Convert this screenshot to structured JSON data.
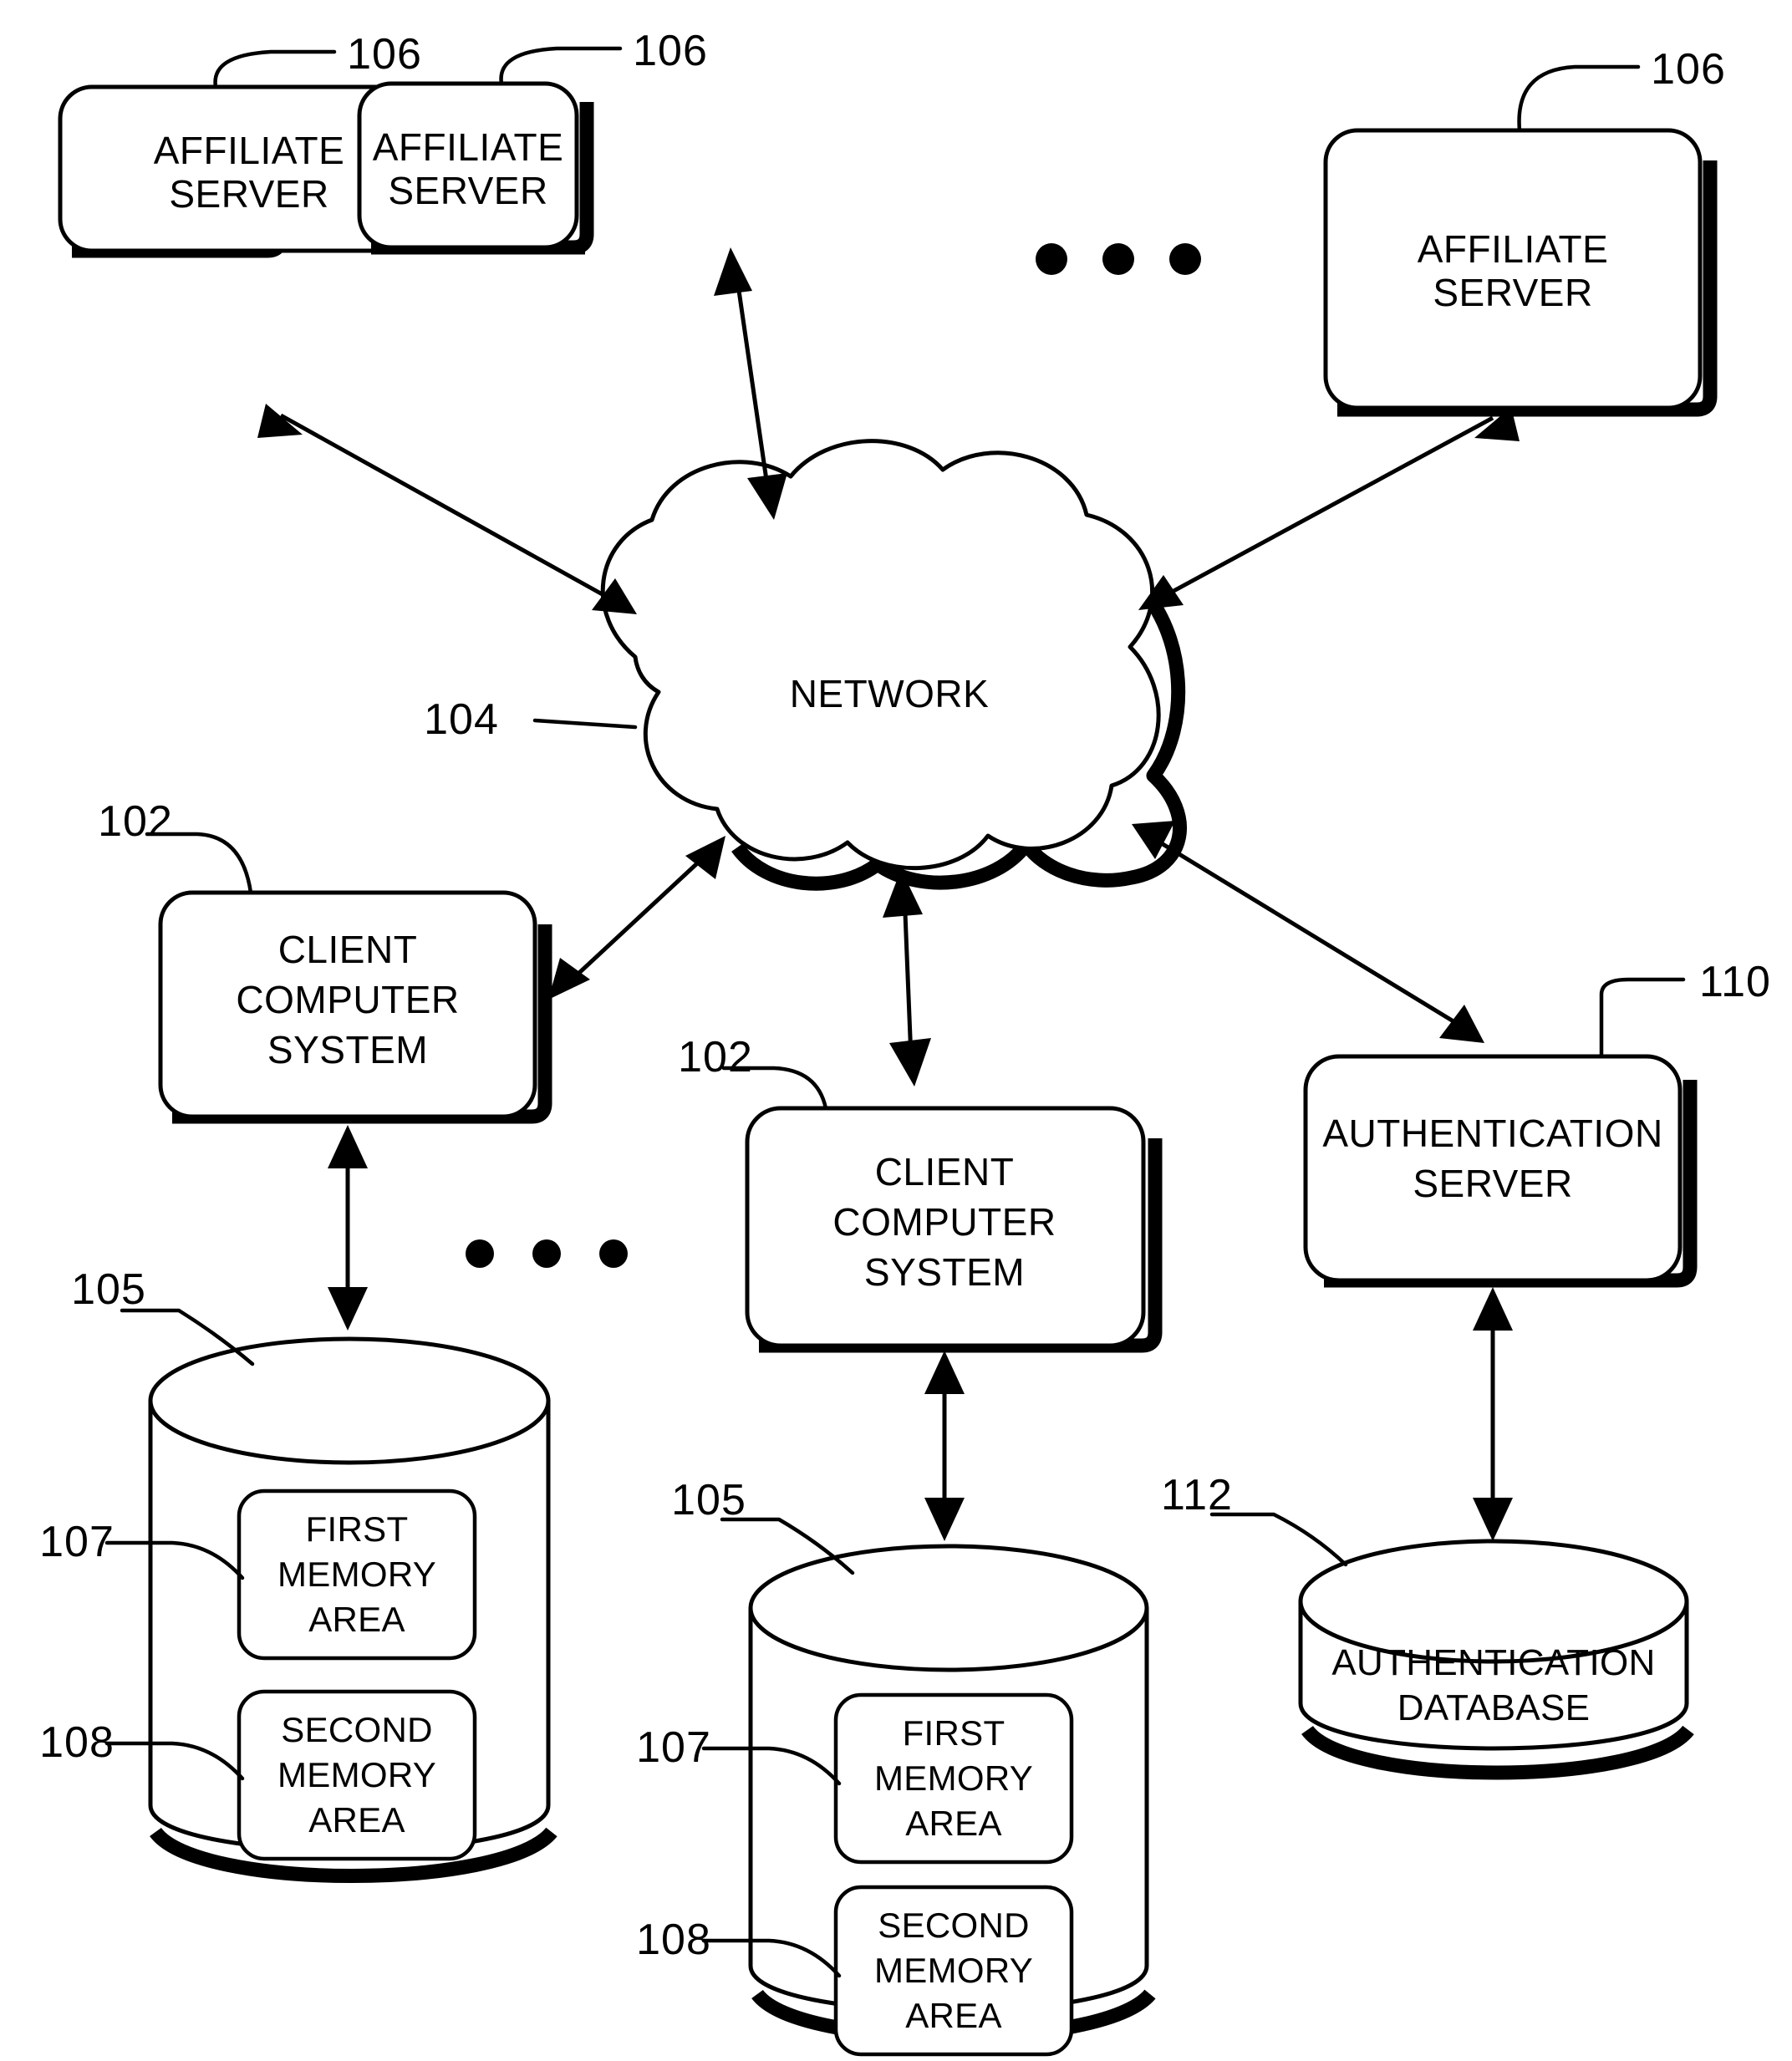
{
  "figure": {
    "type": "patent-network-architecture-diagram",
    "background_color": "#ffffff",
    "line_color": "#000000"
  },
  "nodes": {
    "affiliate_server_1": {
      "label_line1": "AFFILIATE",
      "label_line2": "SERVER",
      "ref": "106"
    },
    "affiliate_server_2": {
      "label_line1": "AFFILIATE",
      "label_line2": "SERVER",
      "ref": "106"
    },
    "affiliate_server_3": {
      "label_line1": "AFFILIATE",
      "label_line2": "SERVER",
      "ref": "106"
    },
    "network_cloud": {
      "label": "NETWORK",
      "ref": "104"
    },
    "client_computer_system_1": {
      "label_line1": "CLIENT",
      "label_line2": "COMPUTER",
      "label_line3": "SYSTEM",
      "ref": "102"
    },
    "client_computer_system_2": {
      "label_line1": "CLIENT",
      "label_line2": "COMPUTER",
      "label_line3": "SYSTEM",
      "ref": "102"
    },
    "authentication_server": {
      "label_line1": "AUTHENTICATION",
      "label_line2": "SERVER",
      "ref": "110"
    },
    "client_memory_1": {
      "ref": "105",
      "first_memory_area": {
        "label_line1": "FIRST",
        "label_line2": "MEMORY",
        "label_line3": "AREA",
        "ref": "107"
      },
      "second_memory_area": {
        "label_line1": "SECOND",
        "label_line2": "MEMORY",
        "label_line3": "AREA",
        "ref": "108"
      }
    },
    "client_memory_2": {
      "ref": "105",
      "first_memory_area": {
        "label_line1": "FIRST",
        "label_line2": "MEMORY",
        "label_line3": "AREA",
        "ref": "107"
      },
      "second_memory_area": {
        "label_line1": "SECOND",
        "label_line2": "MEMORY",
        "label_line3": "AREA",
        "ref": "108"
      }
    },
    "authentication_database": {
      "label_line1": "AUTHENTICATION",
      "label_line2": "DATABASE",
      "ref": "112"
    }
  },
  "ellipsis": {
    "top_row": "• • •",
    "bottom_row": "• • •"
  },
  "reference_numerals": [
    "106",
    "106",
    "106",
    "104",
    "102",
    "102",
    "110",
    "105",
    "105",
    "107",
    "107",
    "108",
    "108",
    "112"
  ]
}
